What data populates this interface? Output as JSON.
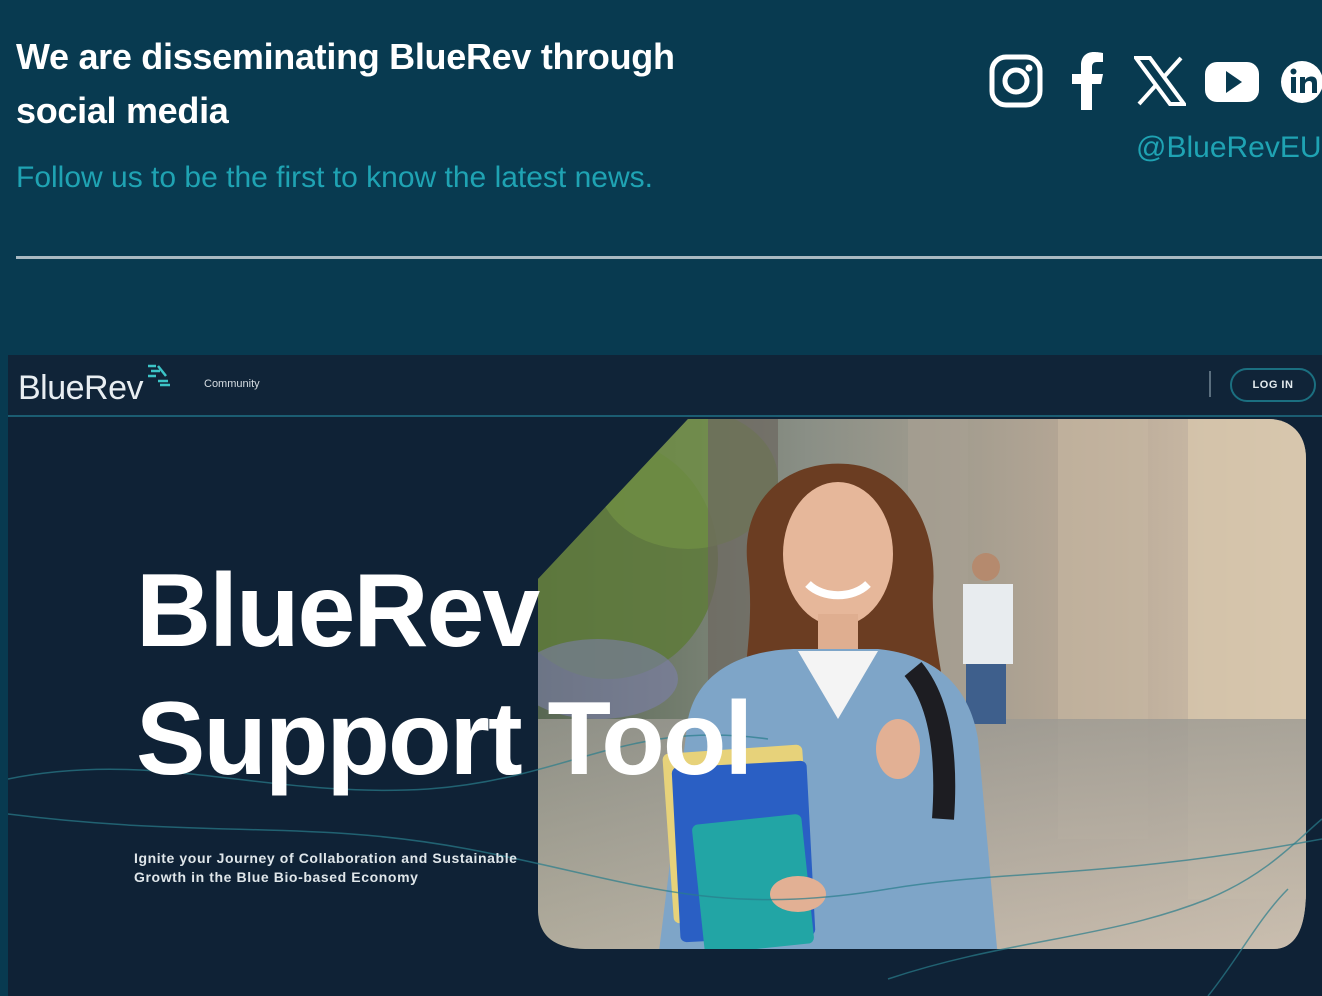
{
  "social": {
    "heading": "We are disseminating BlueRev through social media",
    "subtext": "Follow us to be the first to know the latest news.",
    "handle": "@BlueRevEU",
    "icons": [
      "instagram-icon",
      "facebook-icon",
      "x-icon",
      "youtube-icon",
      "linkedin-icon"
    ]
  },
  "screenshot": {
    "logo": "BlueRev",
    "nav_link": "Community",
    "login_button": "LOG IN",
    "hero_title_line1": "BlueRev",
    "hero_title_line2": "Support Tool",
    "hero_subtitle": "Ignite your Journey of Collaboration and Sustainable Growth in the Blue Bio-based Economy"
  },
  "colors": {
    "background": "#083a50",
    "accent": "#1fa3b3",
    "screenshot_bg": "#0f2236"
  }
}
